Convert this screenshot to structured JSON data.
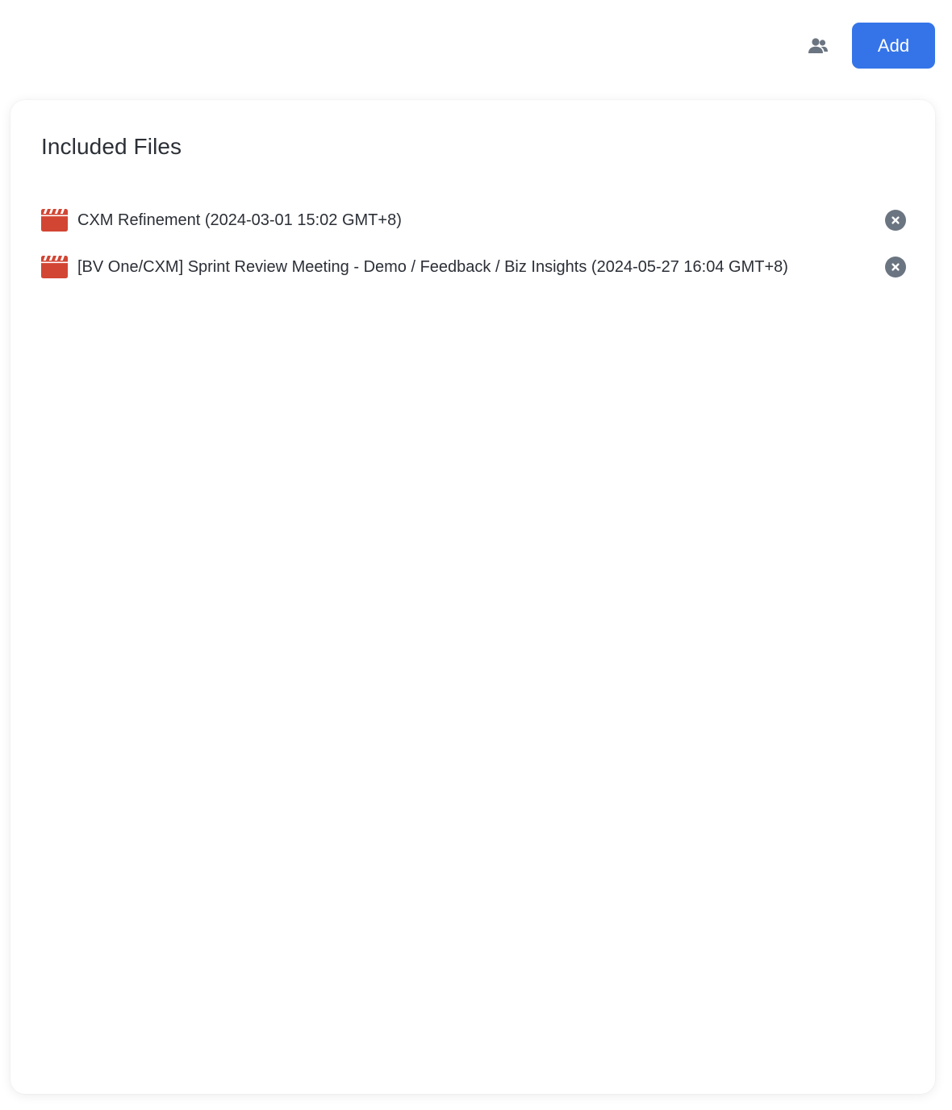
{
  "toolbar": {
    "share_icon": "people-icon",
    "add_label": "Add",
    "accent_color": "#3574e8"
  },
  "card": {
    "title": "Included Files",
    "files": [
      {
        "icon": "video-clapperboard-icon",
        "name": "CXM Refinement (2024-03-01 15:02 GMT+8)",
        "remove_icon": "close-circle-icon"
      },
      {
        "icon": "video-clapperboard-icon",
        "name": "[BV One/CXM] Sprint Review Meeting - Demo / Feedback / Biz Insights (2024-05-27 16:04 GMT+8)",
        "remove_icon": "close-circle-icon"
      }
    ]
  },
  "colors": {
    "file_icon": "#d24533",
    "remove_icon": "#6b7581",
    "text": "#2b2f36"
  }
}
